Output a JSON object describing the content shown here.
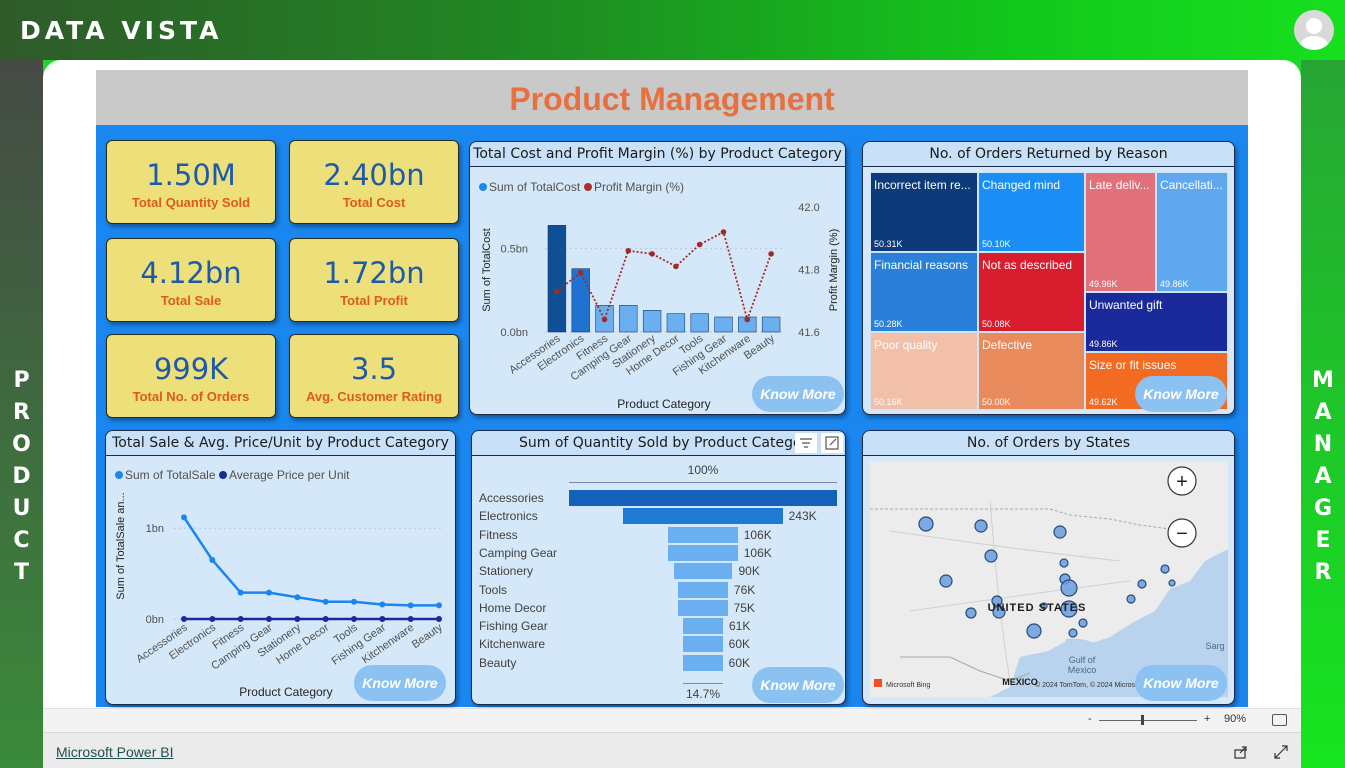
{
  "app": {
    "brand": "DATA VISTA",
    "left_banner": "PRODUCT",
    "right_banner": "MANAGER",
    "powerbi_link": "Microsoft Power BI",
    "zoom_minus": "-",
    "zoom_plus": "+",
    "zoom_level": "90%"
  },
  "report": {
    "title": "Product Management",
    "know_more": "Know More",
    "kpis": [
      {
        "value": "1.50M",
        "label": "Total Quantity Sold"
      },
      {
        "value": "2.40bn",
        "label": "Total Cost"
      },
      {
        "value": "4.12bn",
        "label": "Total Sale"
      },
      {
        "value": "1.72bn",
        "label": "Total Profit"
      },
      {
        "value": "999K",
        "label": "Total No. of Orders"
      },
      {
        "value": "3.5",
        "label": "Avg. Customer Rating"
      }
    ]
  },
  "returns": {
    "title": "No. of Orders Returned by Reason",
    "tiles": [
      {
        "name": "Incorrect item re...",
        "count": "50.31K"
      },
      {
        "name": "Changed mind",
        "count": "50.10K"
      },
      {
        "name": "Late deliv...",
        "count": "49.96K"
      },
      {
        "name": "Cancellati...",
        "count": "49.86K"
      },
      {
        "name": "Financial reasons",
        "count": "50.28K"
      },
      {
        "name": "Not as described",
        "count": "50.08K"
      },
      {
        "name": "Unwanted gift",
        "count": "49.86K"
      },
      {
        "name": "Poor quality",
        "count": "50.16K"
      },
      {
        "name": "Defective",
        "count": "50.00K"
      },
      {
        "name": "Size or fit issues",
        "count": "49.62K"
      }
    ],
    "colors": [
      "#0d3a78",
      "#1a8ef5",
      "#e0707a",
      "#5fa8f0",
      "#2a7fd8",
      "#d81e2e",
      "#1a2a9a",
      "#f2c0a8",
      "#e88a5c",
      "#f36a22"
    ]
  },
  "map": {
    "title": "No. of Orders by States",
    "country_label": "UNITED STATES",
    "neighbor_label": "MEXICO",
    "gulf_label": "Gulf of Mexico",
    "sea_label": "Sarg",
    "provider": "Microsoft Bing",
    "copyright": "© 2024 TomTom, © 2024 Microsoft",
    "zoom_in": "+",
    "zoom_out": "−"
  },
  "chart_data": [
    {
      "type": "bar",
      "title": "Total Cost and Profit Margin (%) by Product Category",
      "xlabel": "Product Category",
      "ylabel": "Sum of TotalCost",
      "y2label": "Profit Margin (%)",
      "categories": [
        "Accessories",
        "Electronics",
        "Fitness",
        "Camping Gear",
        "Stationery",
        "Home Decor",
        "Tools",
        "Fishing Gear",
        "Kitchenware",
        "Beauty"
      ],
      "series": [
        {
          "name": "Sum of TotalCost",
          "type": "bar",
          "values": [
            0.64,
            0.38,
            0.16,
            0.16,
            0.13,
            0.11,
            0.11,
            0.09,
            0.09,
            0.09
          ],
          "color": "#1a6fd0"
        },
        {
          "name": "Profit Margin (%)",
          "type": "line",
          "axis": "right",
          "values": [
            41.73,
            41.79,
            41.64,
            41.86,
            41.85,
            41.81,
            41.88,
            41.92,
            41.64,
            41.85
          ],
          "color": "#b0302a"
        }
      ],
      "yticks": [
        "0.0bn",
        "0.5bn"
      ],
      "ylim": [
        0,
        0.75
      ],
      "y2ticks": [
        "41.6",
        "41.8",
        "42.0"
      ],
      "y2lim": [
        41.6,
        42.0
      ],
      "legend": "top-left"
    },
    {
      "type": "line",
      "title": "Total Sale & Avg. Price/Unit by Product Category",
      "xlabel": "Product Category",
      "ylabel": "Sum of TotalSale an...",
      "categories": [
        "Accessories",
        "Electronics",
        "Fitness",
        "Camping Gear",
        "Stationery",
        "Home Decor",
        "Tools",
        "Fishing Gear",
        "Kitchenware",
        "Beauty"
      ],
      "series": [
        {
          "name": "Sum of TotalSale",
          "values": [
            1.12,
            0.65,
            0.29,
            0.29,
            0.24,
            0.19,
            0.19,
            0.16,
            0.15,
            0.15
          ],
          "color": "#1a86f0"
        },
        {
          "name": "Average Price per Unit",
          "values": [
            0,
            0,
            0,
            0,
            0,
            0,
            0,
            0,
            0,
            0
          ],
          "color": "#1a2a9a"
        }
      ],
      "yticks": [
        "0bn",
        "1bn"
      ],
      "ylim": [
        0,
        1.3
      ],
      "legend": "top-left"
    },
    {
      "type": "bar",
      "orientation": "funnel",
      "title": "Sum of Quantity Sold by Product Category",
      "categories": [
        "Accessories",
        "Electronics",
        "Fitness",
        "Camping Gear",
        "Stationery",
        "Tools",
        "Home Decor",
        "Fishing Gear",
        "Kitchenware",
        "Beauty"
      ],
      "values": [
        409,
        243,
        106,
        106,
        90,
        76,
        75,
        61,
        60,
        60
      ],
      "value_labels": [
        "",
        "243K",
        "106K",
        "106K",
        "90K",
        "76K",
        "75K",
        "61K",
        "60K",
        "60K"
      ],
      "top_label": "100%",
      "bottom_label": "14.7%"
    }
  ]
}
